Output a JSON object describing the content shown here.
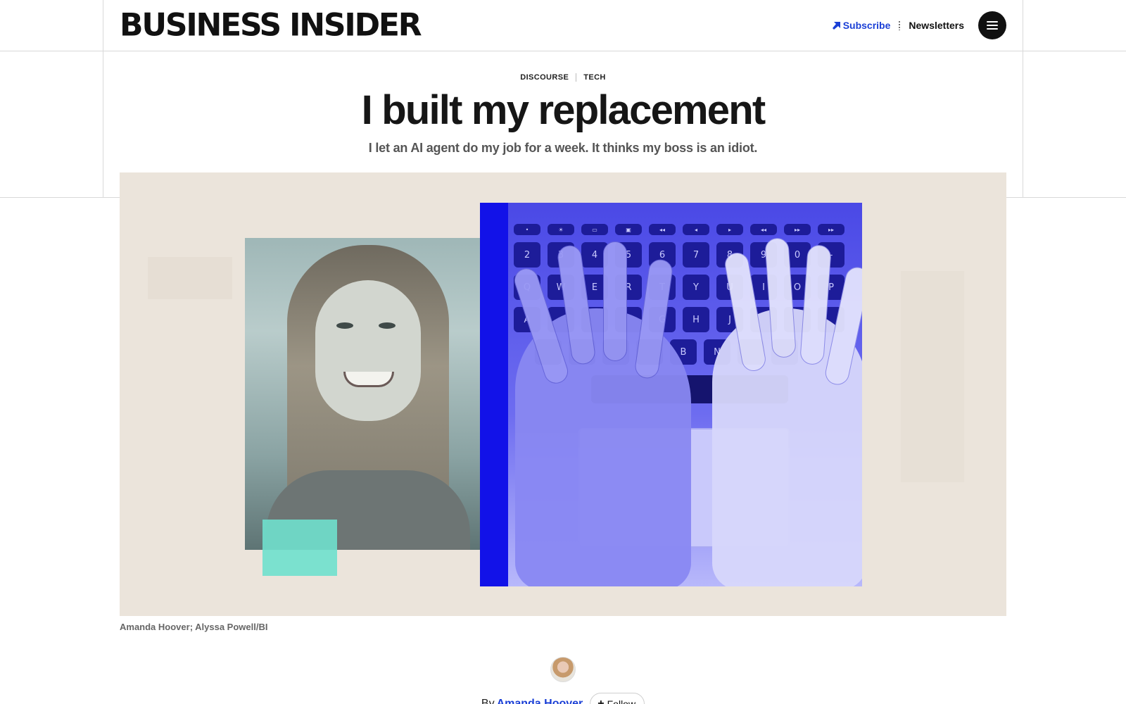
{
  "header": {
    "logo": "BUSINESS INSIDER",
    "subscribe_label": "Subscribe",
    "newsletters_label": "Newsletters",
    "menu_icon": "hamburger-menu-icon",
    "accent_color": "#1a3fd6"
  },
  "article": {
    "categories": [
      "DISCOURSE",
      "TECH"
    ],
    "headline": "I built my replacement",
    "dek": "I let an AI agent do my job for a week. It thinks my boss is an idiot.",
    "image_credit": "Amanda Hoover; Alyssa Powell/BI"
  },
  "byline": {
    "by": "By",
    "author": "Amanda Hoover",
    "follow_label": "Follow"
  },
  "hero_keyboard": {
    "fn_row": [
      "•",
      "☀",
      "▭",
      "▣",
      "◂◂",
      "◂",
      "▸",
      "◂◂",
      "▸▸",
      "▸▸",
      "✈"
    ],
    "number_row": [
      "2",
      "3",
      "4",
      "5",
      "6",
      "7",
      "8",
      "9",
      "0",
      "-"
    ],
    "qwerty_row": [
      "Q",
      "W",
      "E",
      "R",
      "T",
      "Y",
      "U",
      "I",
      "O",
      "P",
      "["
    ],
    "home_row": [
      "A",
      "",
      "",
      "",
      "G",
      "H",
      "J",
      "",
      "",
      ""
    ],
    "bottom_row": [
      "",
      "",
      "",
      "",
      "B",
      "N",
      "",
      "",
      ""
    ]
  }
}
